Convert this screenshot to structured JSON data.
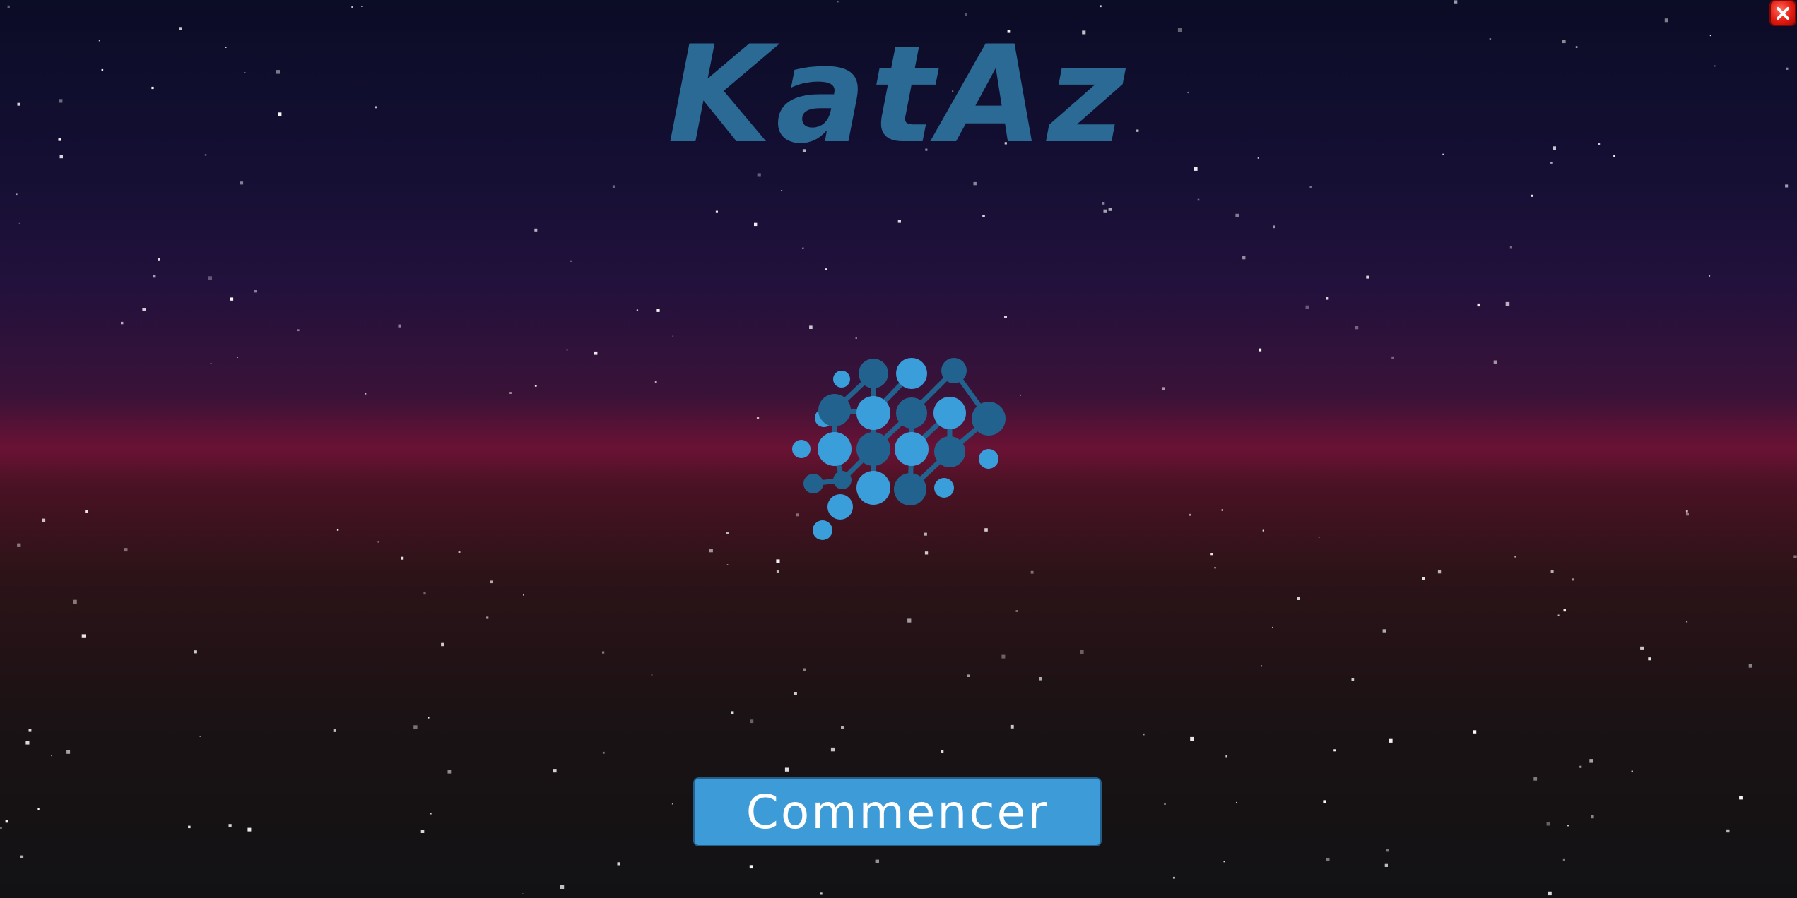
{
  "game": {
    "title": "KatAz",
    "start_button_label": "Commencer"
  },
  "icons": {
    "close": "close-icon",
    "logo": "brain-network-icon"
  },
  "colors": {
    "title": "#2a6a95",
    "logo_light": "#3a9edb",
    "logo_dark": "#22628f",
    "button_bg": "#3d9bd8",
    "close_bg": "#e51c12"
  }
}
